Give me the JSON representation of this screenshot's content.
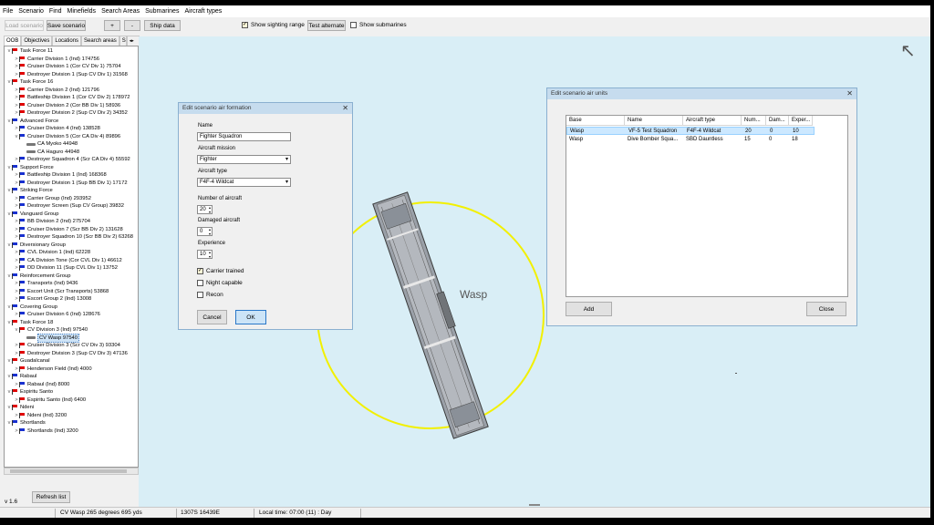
{
  "menu": [
    "File",
    "Scenario",
    "Find",
    "Minefields",
    "Search Areas",
    "Submarines",
    "Aircraft types"
  ],
  "toolbar": {
    "load_scenario": "Load scenario",
    "save_scenario": "Save scenario",
    "plus": "+",
    "minus": "-",
    "ship_data": "Ship data",
    "show_sighting_range": "Show sighting range",
    "show_sighting_range_checked": true,
    "test_alternate": "Test alternate",
    "show_submarines": "Show submarines",
    "show_submarines_checked": false
  },
  "left_tabs": [
    "OOB",
    "Objectives",
    "Locations",
    "Search areas",
    "S"
  ],
  "tree": [
    {
      "level": 0,
      "exp": "v",
      "flag": "red",
      "label": "Task Force 11"
    },
    {
      "level": 1,
      "exp": ">",
      "flag": "red",
      "label": "Carrier Division 1 (Ind) 174756"
    },
    {
      "level": 1,
      "exp": ">",
      "flag": "red",
      "label": "Cruiser Division 1 (Cor CV Div 1) 75704"
    },
    {
      "level": 1,
      "exp": ">",
      "flag": "red",
      "label": "Destroyer Division 1 (Sup CV Div 1) 31568"
    },
    {
      "level": 0,
      "exp": "v",
      "flag": "red",
      "label": "Task Force 16"
    },
    {
      "level": 1,
      "exp": ">",
      "flag": "red",
      "label": "Carrier Division 2 (Ind) 121796"
    },
    {
      "level": 1,
      "exp": ">",
      "flag": "red",
      "label": "Battleship Division 1 (Cor CV Div 2) 178972"
    },
    {
      "level": 1,
      "exp": ">",
      "flag": "red",
      "label": "Cruiser Division 2 (Cor BB Div 1) 58936"
    },
    {
      "level": 1,
      "exp": ">",
      "flag": "red",
      "label": "Destroyer Division 2 (Sup CV Div 2) 34352"
    },
    {
      "level": 0,
      "exp": "v",
      "flag": "blue",
      "label": "Advanced Force"
    },
    {
      "level": 1,
      "exp": ">",
      "flag": "blue",
      "label": "Cruiser Division 4 (Ind) 138528"
    },
    {
      "level": 1,
      "exp": "v",
      "flag": "blue",
      "label": "Cruiser Division 5 (Cor CA Div 4) 89896"
    },
    {
      "level": 2,
      "exp": "",
      "flag": "ship",
      "label": "CA Myoko 44948"
    },
    {
      "level": 2,
      "exp": "",
      "flag": "ship",
      "label": "CA Haguro 44948"
    },
    {
      "level": 1,
      "exp": ">",
      "flag": "blue",
      "label": "Destroyer Squadron 4 (Scr CA Div 4) 55592"
    },
    {
      "level": 0,
      "exp": "v",
      "flag": "blue",
      "label": "Support Force"
    },
    {
      "level": 1,
      "exp": ">",
      "flag": "blue",
      "label": "Battleship Division 1 (Ind) 168368"
    },
    {
      "level": 1,
      "exp": ">",
      "flag": "blue",
      "label": "Destroyer Division 1 (Sup BB Div 1) 17172"
    },
    {
      "level": 0,
      "exp": "v",
      "flag": "blue",
      "label": "Striking Force"
    },
    {
      "level": 1,
      "exp": ">",
      "flag": "blue",
      "label": "Carrier Group (Ind) 293952"
    },
    {
      "level": 1,
      "exp": ">",
      "flag": "blue",
      "label": "Destroyer Screen (Sup CV Group) 39832"
    },
    {
      "level": 0,
      "exp": "v",
      "flag": "blue",
      "label": "Vanguard Group"
    },
    {
      "level": 1,
      "exp": ">",
      "flag": "blue",
      "label": "BB Division 2 (Ind) 275704"
    },
    {
      "level": 1,
      "exp": ">",
      "flag": "blue",
      "label": "Cruiser Division 7 (Scr BB Div 2) 131628"
    },
    {
      "level": 1,
      "exp": ">",
      "flag": "blue",
      "label": "Destroyer Squadron 10 (Scr BB Div 2) 63268"
    },
    {
      "level": 0,
      "exp": "v",
      "flag": "blue",
      "label": "Diversionary Group"
    },
    {
      "level": 1,
      "exp": ">",
      "flag": "blue",
      "label": "CVL Division 1 (Ind) 62228"
    },
    {
      "level": 1,
      "exp": ">",
      "flag": "blue",
      "label": "CA Division Tone (Cor CVL Div 1) 46612"
    },
    {
      "level": 1,
      "exp": ">",
      "flag": "blue",
      "label": "DD Division 11 (Sup CVL Div 1) 13752"
    },
    {
      "level": 0,
      "exp": "v",
      "flag": "blue",
      "label": "Reinforcement Group"
    },
    {
      "level": 1,
      "exp": ">",
      "flag": "blue",
      "label": "Transports (Ind) 9436"
    },
    {
      "level": 1,
      "exp": ">",
      "flag": "blue",
      "label": "Escort Unit (Scr Transports) 53868"
    },
    {
      "level": 1,
      "exp": ">",
      "flag": "blue",
      "label": "Escort Group 2 (Ind) 13008"
    },
    {
      "level": 0,
      "exp": "v",
      "flag": "blue",
      "label": "Covering Group"
    },
    {
      "level": 1,
      "exp": ">",
      "flag": "blue",
      "label": "Cruiser Division 6 (Ind) 128676"
    },
    {
      "level": 0,
      "exp": "v",
      "flag": "red",
      "label": "Task Force 18"
    },
    {
      "level": 1,
      "exp": "v",
      "flag": "red",
      "label": "CV Division 3 (Ind) 97540"
    },
    {
      "level": 2,
      "exp": "",
      "flag": "ship",
      "label": "CV Wasp 97540",
      "selected": true
    },
    {
      "level": 1,
      "exp": ">",
      "flag": "red",
      "label": "Cruiser Division 3 (Scr CV Div 3) 93304"
    },
    {
      "level": 1,
      "exp": ">",
      "flag": "red",
      "label": "Destroyer Division 3 (Sup CV Div 3) 47136"
    },
    {
      "level": 0,
      "exp": "v",
      "flag": "red",
      "label": "Guadalcanal"
    },
    {
      "level": 1,
      "exp": ">",
      "flag": "red",
      "label": "Henderson Field (Ind) 4000"
    },
    {
      "level": 0,
      "exp": "v",
      "flag": "blue",
      "label": "Rabaul"
    },
    {
      "level": 1,
      "exp": ">",
      "flag": "blue",
      "label": "Rabaul (Ind) 8000"
    },
    {
      "level": 0,
      "exp": "v",
      "flag": "red",
      "label": "Espiritu Santo"
    },
    {
      "level": 1,
      "exp": ">",
      "flag": "red",
      "label": "Espiritu Santo (Ind) 6400"
    },
    {
      "level": 0,
      "exp": "v",
      "flag": "red",
      "label": "Ndeni"
    },
    {
      "level": 1,
      "exp": ">",
      "flag": "red",
      "label": "Ndeni (Ind) 3200"
    },
    {
      "level": 0,
      "exp": "v",
      "flag": "blue",
      "label": "Shortlands"
    },
    {
      "level": 1,
      "exp": ">",
      "flag": "blue",
      "label": "Shortlands (Ind) 3200"
    }
  ],
  "refresh_button": "Refresh list",
  "version": "v 1.6",
  "map": {
    "ship_label": "Wasp",
    "compass_arrow": "↖",
    "range_circle_color": "#f2f000",
    "background_color": "#d9eef6"
  },
  "formation_dialog": {
    "title": "Edit scenario air formation",
    "name_label": "Name",
    "name_value": "Fighter Squadron",
    "mission_label": "Aircraft mission",
    "mission_value": "Fighter",
    "type_label": "Aircraft type",
    "type_value": "F4F-4 Wildcat",
    "number_label": "Number of aircraft",
    "number_value": "20",
    "damaged_label": "Damaged aircraft",
    "damaged_value": "0",
    "experience_label": "Experience",
    "experience_value": "10",
    "carrier_trained": "Carrier trained",
    "carrier_trained_checked": true,
    "night_capable": "Night capable",
    "night_capable_checked": false,
    "recon": "Recon",
    "recon_checked": false,
    "cancel": "Cancel",
    "ok": "OK"
  },
  "units_dialog": {
    "title": "Edit scenario air units",
    "columns": [
      "Base",
      "Name",
      "Aircraft type",
      "Num...",
      "Dam...",
      "Exper..."
    ],
    "rows": [
      [
        "Wasp",
        "VF-5 Test Squadron",
        "F4F-4 Wildcat",
        "20",
        "0",
        "10"
      ],
      [
        "Wasp",
        "Dive Bomber Squa...",
        "SBD Dauntless",
        "15",
        "0",
        "18"
      ]
    ],
    "selected_row": 0,
    "add": "Add",
    "close": "Close"
  },
  "status": {
    "ship": "CV Wasp 265 degrees 695 yds",
    "coords": "1307S 16439E",
    "time": "Local time: 07:00 (11) : Day"
  }
}
